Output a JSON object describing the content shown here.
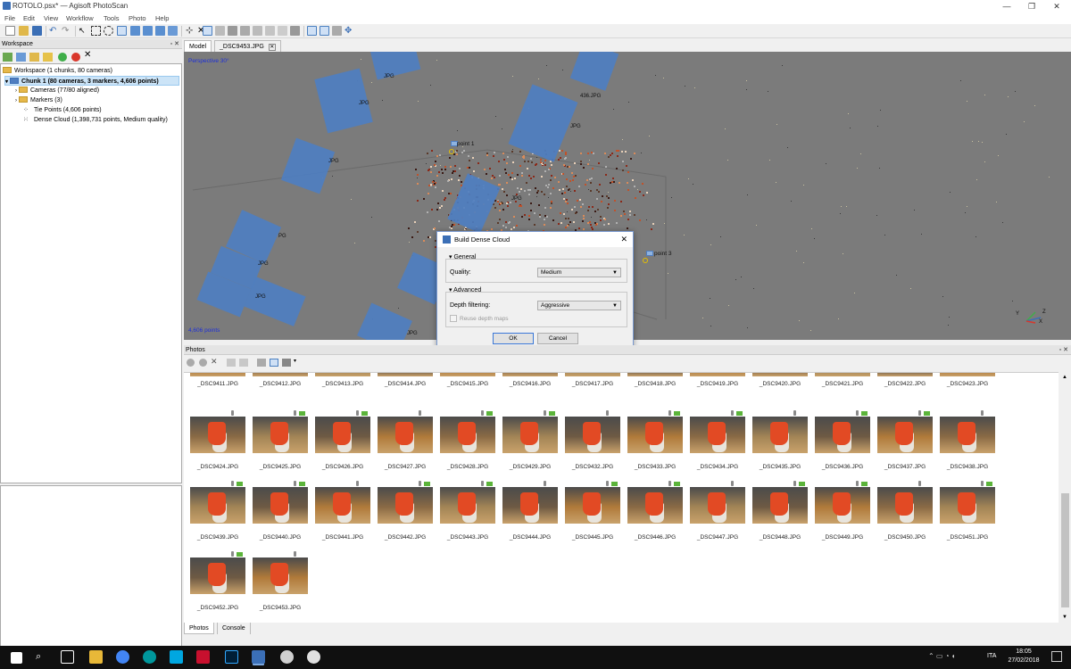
{
  "window": {
    "title": "ROTOLO.psx* — Agisoft PhotoScan"
  },
  "menu": [
    "File",
    "Edit",
    "View",
    "Workflow",
    "Tools",
    "Photo",
    "Help"
  ],
  "workspace": {
    "panel_title": "Workspace",
    "root": "Workspace (1 chunks, 80 cameras)",
    "chunk": "Chunk 1 (80 cameras, 3 markers, 4,606 points)",
    "items": [
      {
        "label": "Cameras (77/80 aligned)"
      },
      {
        "label": "Markers (3)"
      },
      {
        "label": "Tie Points (4,606 points)"
      },
      {
        "label": "Dense Cloud (1,398,731 points, Medium quality)"
      }
    ]
  },
  "view": {
    "tabs": [
      "Model",
      "_DSC9453.JPG"
    ],
    "perspective": "Perspective 30°",
    "points": "4,606 points",
    "markers": [
      "point 1",
      "point 3"
    ],
    "camera_labels": [
      "JPG",
      "436.JPG",
      "JPG",
      "JPG",
      "JPG",
      "PG",
      "JPG",
      "JPG",
      "JPG",
      "JPG",
      "JPG",
      "JPG",
      "JPG"
    ],
    "axes": [
      "Y",
      "Z",
      "X"
    ]
  },
  "dialog": {
    "title": "Build Dense Cloud",
    "general": "General",
    "quality_label": "Quality:",
    "quality_value": "Medium",
    "advanced": "Advanced",
    "depth_label": "Depth filtering:",
    "depth_value": "Aggressive",
    "reuse_label": "Reuse depth maps",
    "ok": "OK",
    "cancel": "Cancel"
  },
  "photos": {
    "panel_title": "Photos",
    "rows": [
      [
        "_DSC9411.JPG",
        "_DSC9412.JPG",
        "_DSC9413.JPG",
        "_DSC9414.JPG",
        "_DSC9415.JPG",
        "_DSC9416.JPG",
        "_DSC9417.JPG",
        "_DSC9418.JPG",
        "_DSC9419.JPG",
        "_DSC9420.JPG",
        "_DSC9421.JPG",
        "_DSC9422.JPG",
        "_DSC9423.JPG"
      ],
      [
        "_DSC9424.JPG",
        "_DSC9425.JPG",
        "_DSC9426.JPG",
        "_DSC9427.JPG",
        "_DSC9428.JPG",
        "_DSC9429.JPG",
        "_DSC9432.JPG",
        "_DSC9433.JPG",
        "_DSC9434.JPG",
        "_DSC9435.JPG",
        "_DSC9436.JPG",
        "_DSC9437.JPG",
        "_DSC9438.JPG"
      ],
      [
        "_DSC9439.JPG",
        "_DSC9440.JPG",
        "_DSC9441.JPG",
        "_DSC9442.JPG",
        "_DSC9443.JPG",
        "_DSC9444.JPG",
        "_DSC9445.JPG",
        "_DSC9446.JPG",
        "_DSC9447.JPG",
        "_DSC9448.JPG",
        "_DSC9449.JPG",
        "_DSC9450.JPG",
        "_DSC9451.JPG"
      ],
      [
        "_DSC9452.JPG",
        "_DSC9453.JPG"
      ]
    ],
    "bottom_tabs": [
      "Photos",
      "Console"
    ]
  },
  "taskbar": {
    "lang": "ITA",
    "time": "18:05",
    "date": "27/02/2018"
  },
  "colors": {
    "camera_blue": "#4f7ec0",
    "viewport_bg": "#7b7b7b",
    "marker_flag": "#5bb43a"
  }
}
